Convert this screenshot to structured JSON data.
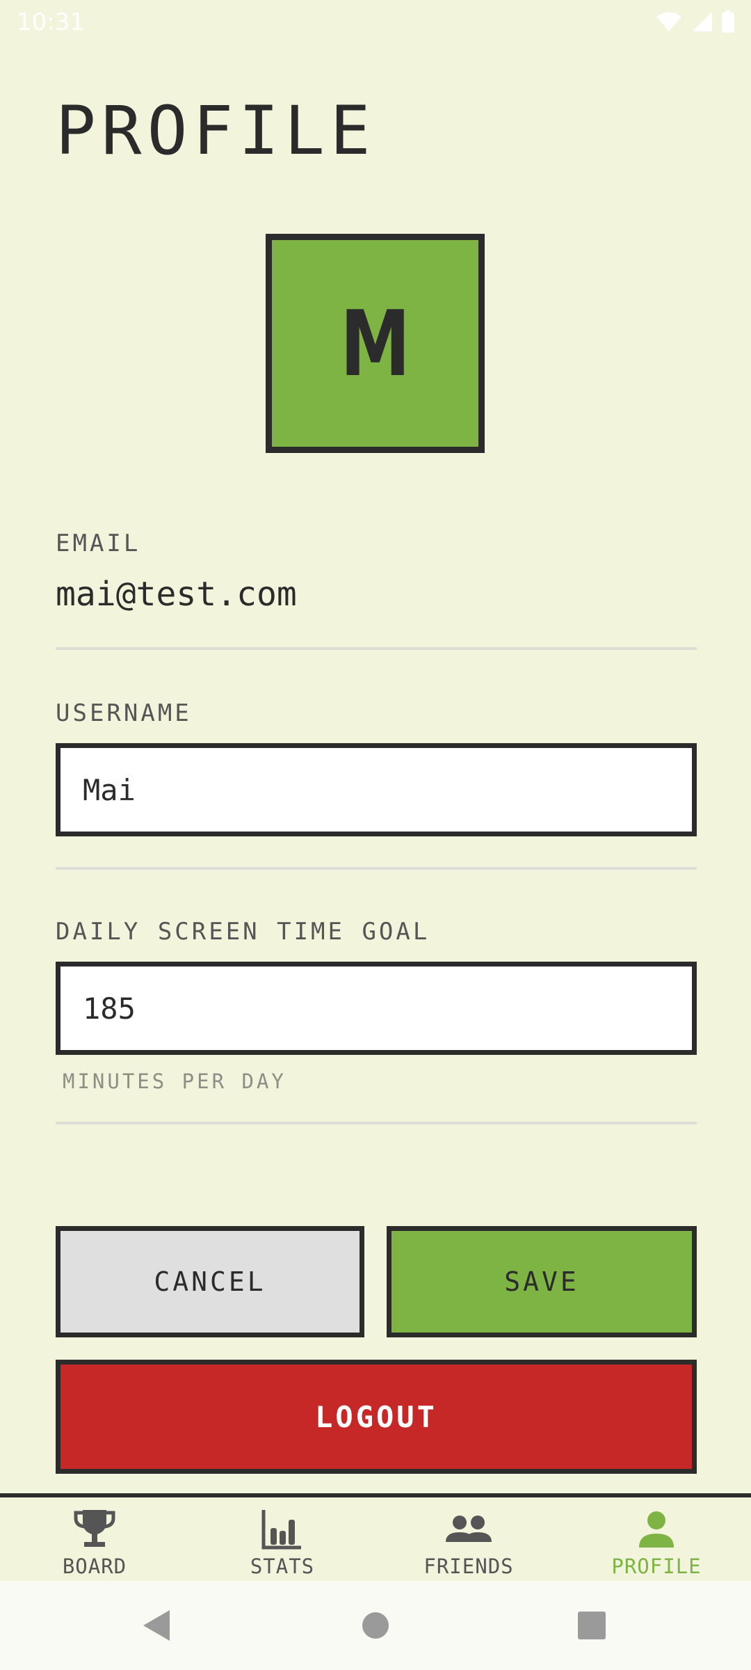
{
  "status_bar": {
    "time": "10:31"
  },
  "page": {
    "title": "PROFILE"
  },
  "avatar": {
    "letter": "M",
    "color": "#7EB443"
  },
  "email": {
    "label": "EMAIL",
    "value": "mai@test.com"
  },
  "username": {
    "label": "USERNAME",
    "value": "Mai"
  },
  "goal": {
    "label": "DAILY SCREEN TIME GOAL",
    "value": "185",
    "hint": "MINUTES PER DAY"
  },
  "actions": {
    "cancel": "CANCEL",
    "save": "SAVE",
    "logout": "LOGOUT"
  },
  "nav": {
    "items": [
      {
        "label": "BOARD",
        "icon": "trophy-icon"
      },
      {
        "label": "STATS",
        "icon": "bar-chart-icon"
      },
      {
        "label": "FRIENDS",
        "icon": "people-icon"
      },
      {
        "label": "PROFILE",
        "icon": "person-icon",
        "active": true
      }
    ]
  },
  "colors": {
    "background": "#F3F4DC",
    "accent": "#7EB443",
    "danger": "#C62828",
    "ink": "#2B2B2B"
  }
}
